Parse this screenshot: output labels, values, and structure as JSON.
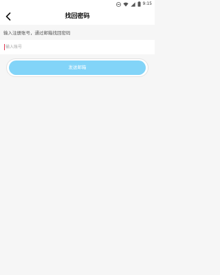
{
  "status_bar": {
    "time": "9:15",
    "icons": [
      "minus-circle-icon",
      "wifi-icon",
      "signal-icon",
      "battery-icon"
    ]
  },
  "header": {
    "title": "找回密码",
    "back_icon": "chevron-left-icon"
  },
  "form": {
    "instruction": "输入注册账号，通过邮箱找回密码",
    "account_placeholder": "输入账号",
    "account_value": ""
  },
  "actions": {
    "send_email_label": "发送邮箱"
  },
  "colors": {
    "button": "#82d4f8",
    "cursor": "#e0304a",
    "background": "#f6f6f6"
  }
}
